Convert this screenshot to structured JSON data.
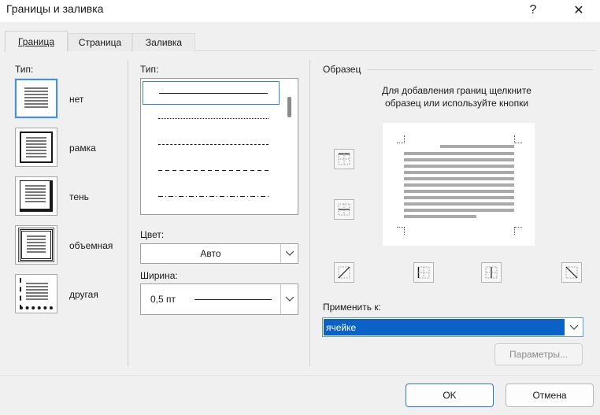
{
  "window": {
    "title": "Границы и заливка",
    "help_label": "?",
    "close_label": "✕"
  },
  "tabs": [
    {
      "label": "Граница",
      "active": true
    },
    {
      "label": "Страница",
      "active": false
    },
    {
      "label": "Заливка",
      "active": false
    }
  ],
  "settings": {
    "heading": "Тип:",
    "items": [
      {
        "label": "нет",
        "icon": "setting-none-icon",
        "selected": true
      },
      {
        "label": "рамка",
        "icon": "setting-box-icon",
        "selected": false
      },
      {
        "label": "тень",
        "icon": "setting-shadow-icon",
        "selected": false
      },
      {
        "label": "объемная",
        "icon": "setting-3d-icon",
        "selected": false
      },
      {
        "label": "другая",
        "icon": "setting-custom-icon",
        "selected": false
      }
    ]
  },
  "style": {
    "heading": "Тип:",
    "items": [
      {
        "name": "solid",
        "selected": true
      },
      {
        "name": "dotted",
        "selected": false
      },
      {
        "name": "small-dash",
        "selected": false
      },
      {
        "name": "dash",
        "selected": false
      },
      {
        "name": "dash-dot",
        "selected": false
      }
    ]
  },
  "color": {
    "label": "Цвет:",
    "value": "Авто"
  },
  "width": {
    "label": "Ширина:",
    "value": "0,5 пт"
  },
  "preview": {
    "heading": "Образец",
    "hint_line1": "Для добавления границ щелкните",
    "hint_line2": "образец или используйте кнопки",
    "buttons": [
      "border-top-icon",
      "border-inside-horizontal-icon",
      "diagonal-up-icon",
      "border-left-icon",
      "border-inside-vertical-icon",
      "diagonal-down-icon"
    ]
  },
  "apply_to": {
    "label": "Применить к:",
    "value": "ячейке"
  },
  "buttons": {
    "options": "Параметры...",
    "ok": "OK",
    "cancel": "Отмена"
  },
  "colors": {
    "accent": "#0a62c9",
    "selection_border": "#4a90d9",
    "dialog_bg": "#f0f0f0"
  }
}
